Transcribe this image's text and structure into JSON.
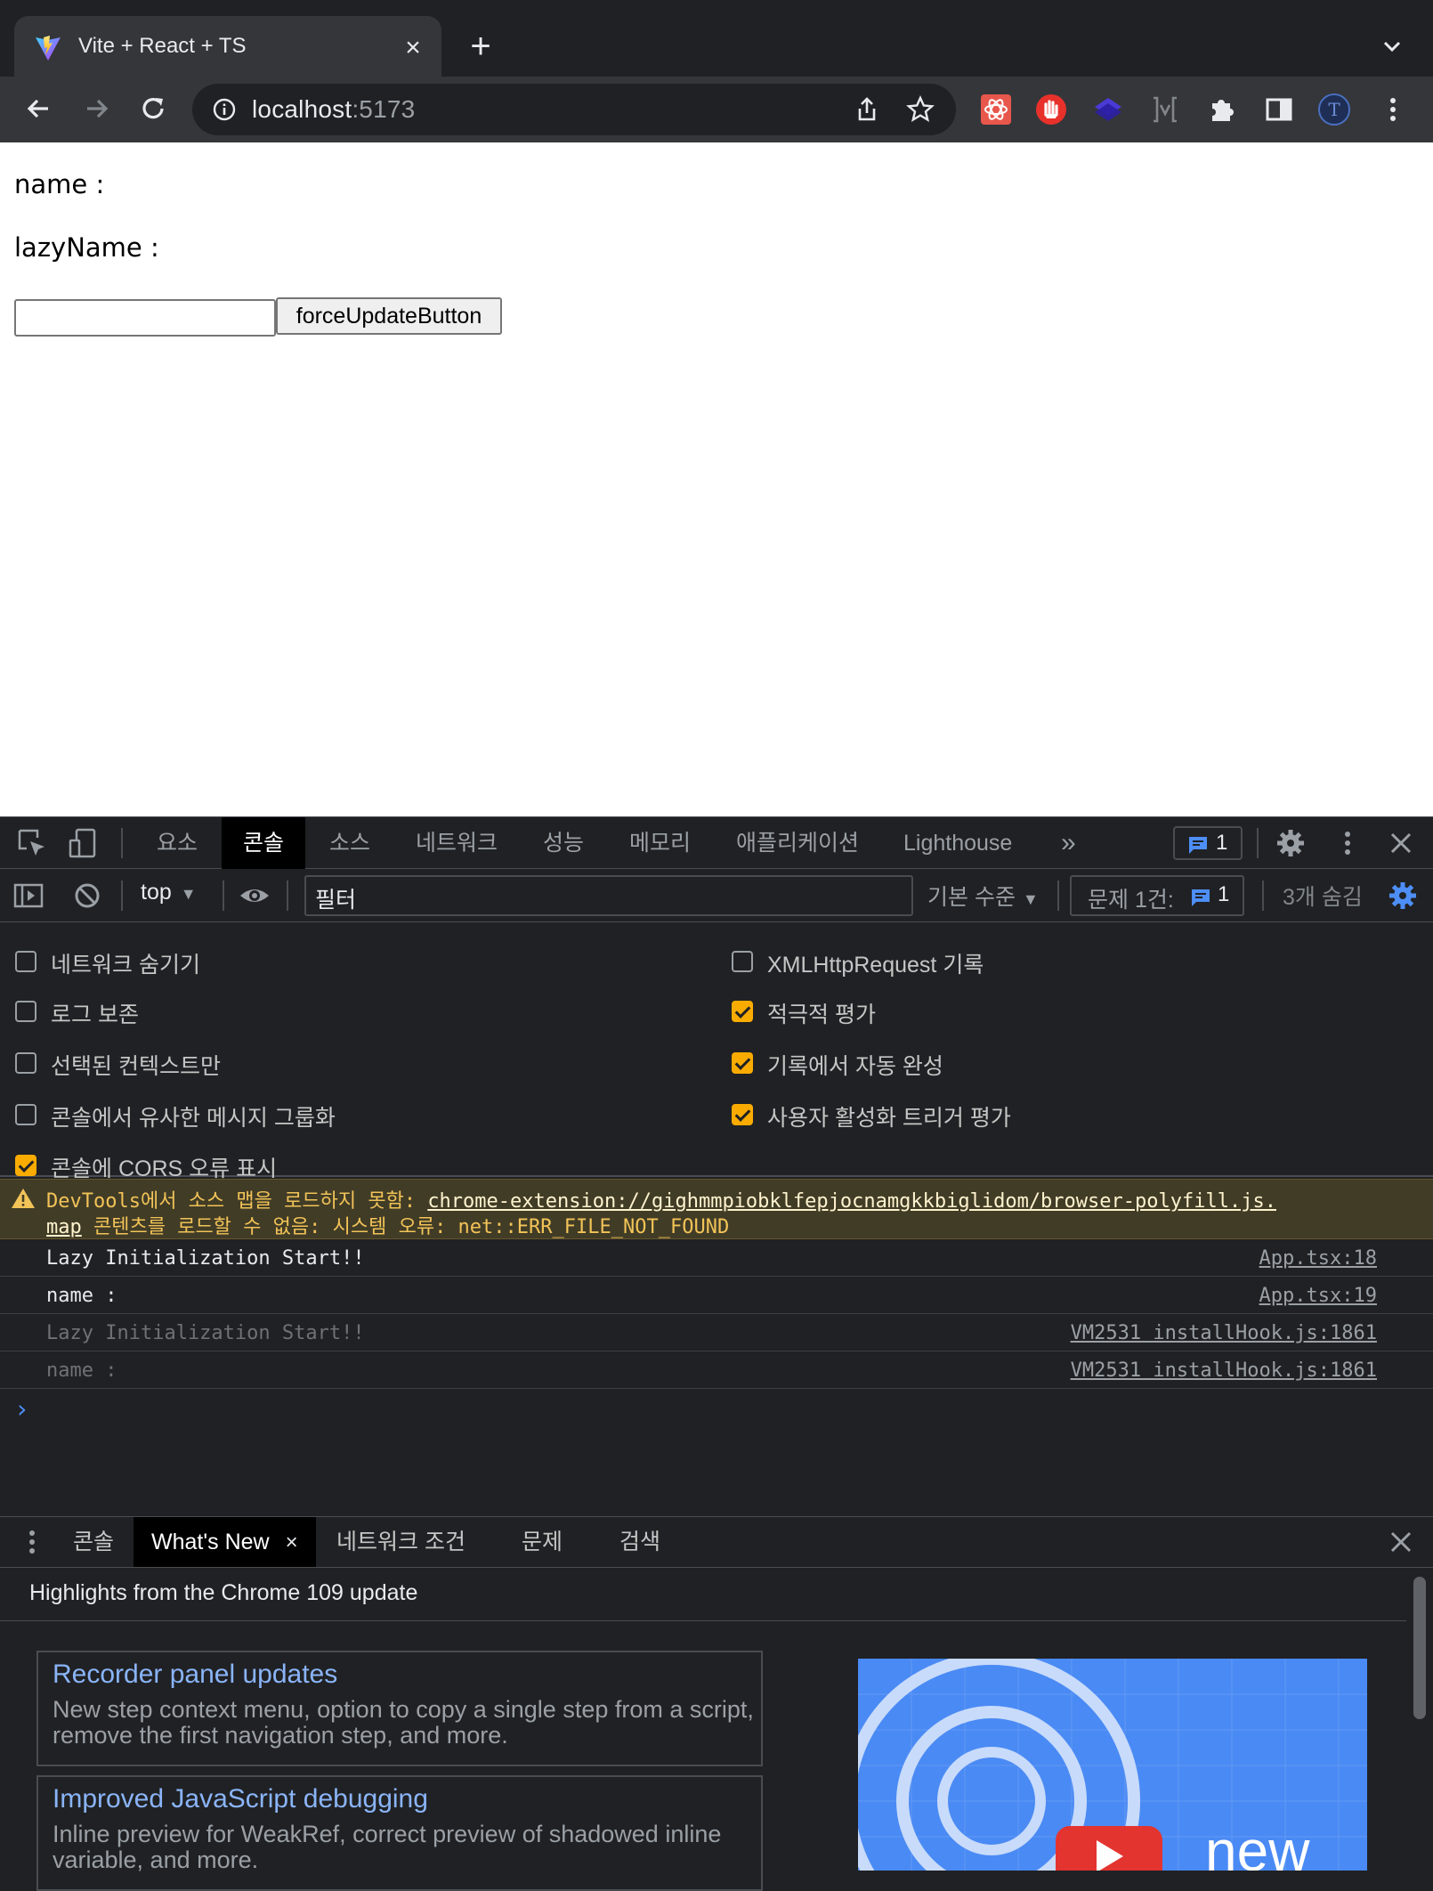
{
  "browser": {
    "tab_title": "Vite + React + TS",
    "url_host": "localhost",
    "url_port": ":5173"
  },
  "page": {
    "name_label": "name :",
    "lazy_name_label": "lazyName :",
    "input_value": "",
    "button_label": "forceUpdateButton"
  },
  "devtools": {
    "tabs": [
      "요소",
      "콘솔",
      "소스",
      "네트워크",
      "성능",
      "메모리",
      "애플리케이션",
      "Lighthouse"
    ],
    "active_tab": "콘솔",
    "more": "»",
    "issues_count": "1",
    "console_bar": {
      "context": "top",
      "filter_placeholder": "필터",
      "level": "기본 수준",
      "issues_label": "문제 1건:",
      "issues_count": "1",
      "hidden": "3개 숨김"
    },
    "settings": {
      "left": [
        {
          "label": "네트워크 숨기기",
          "checked": false
        },
        {
          "label": "로그 보존",
          "checked": false
        },
        {
          "label": "선택된 컨텍스트만",
          "checked": false
        },
        {
          "label": "콘솔에서 유사한 메시지 그룹화",
          "checked": false
        },
        {
          "label": "콘솔에 CORS 오류 표시",
          "checked": true
        }
      ],
      "right": [
        {
          "label": "XMLHttpRequest 기록",
          "checked": false
        },
        {
          "label": "적극적 평가",
          "checked": true
        },
        {
          "label": "기록에서 자동 완성",
          "checked": true
        },
        {
          "label": "사용자 활성화 트리거 평가",
          "checked": true
        }
      ]
    },
    "warning": {
      "prefix": "DevTools에서 소스 맵을 로드하지 못함: ",
      "link_part1": "chrome-extension://gighmmpiobklfepjocnamgkkbiglidom/browser-polyfill.js.",
      "link_part2": "map",
      "suffix": " 콘텐츠를 로드할 수 없음: 시스템 오류: net::ERR_FILE_NOT_FOUND"
    },
    "logs": [
      {
        "message": "Lazy Initialization Start!!",
        "source": "App.tsx:18",
        "dim": false
      },
      {
        "message": "name :",
        "source": "App.tsx:19",
        "dim": false
      },
      {
        "message": "Lazy Initialization Start!!",
        "source": "VM2531 installHook.js:1861",
        "dim": true
      },
      {
        "message": "name :",
        "source": "VM2531 installHook.js:1861",
        "dim": true
      }
    ],
    "prompt": "›",
    "drawer": {
      "tabs": [
        "콘솔",
        "What's New",
        "네트워크 조건",
        "문제",
        "검색"
      ],
      "active_tab": "What's New",
      "close": "×",
      "headline": "Highlights from the Chrome 109 update",
      "cards": [
        {
          "title": "Recorder panel updates",
          "desc": "New step context menu, option to copy a single step from a script, remove the first navigation step, and more."
        },
        {
          "title": "Improved JavaScript debugging",
          "desc": "Inline preview for WeakRef, correct preview of shadowed inline variable, and more."
        }
      ],
      "video_text": "new"
    }
  }
}
